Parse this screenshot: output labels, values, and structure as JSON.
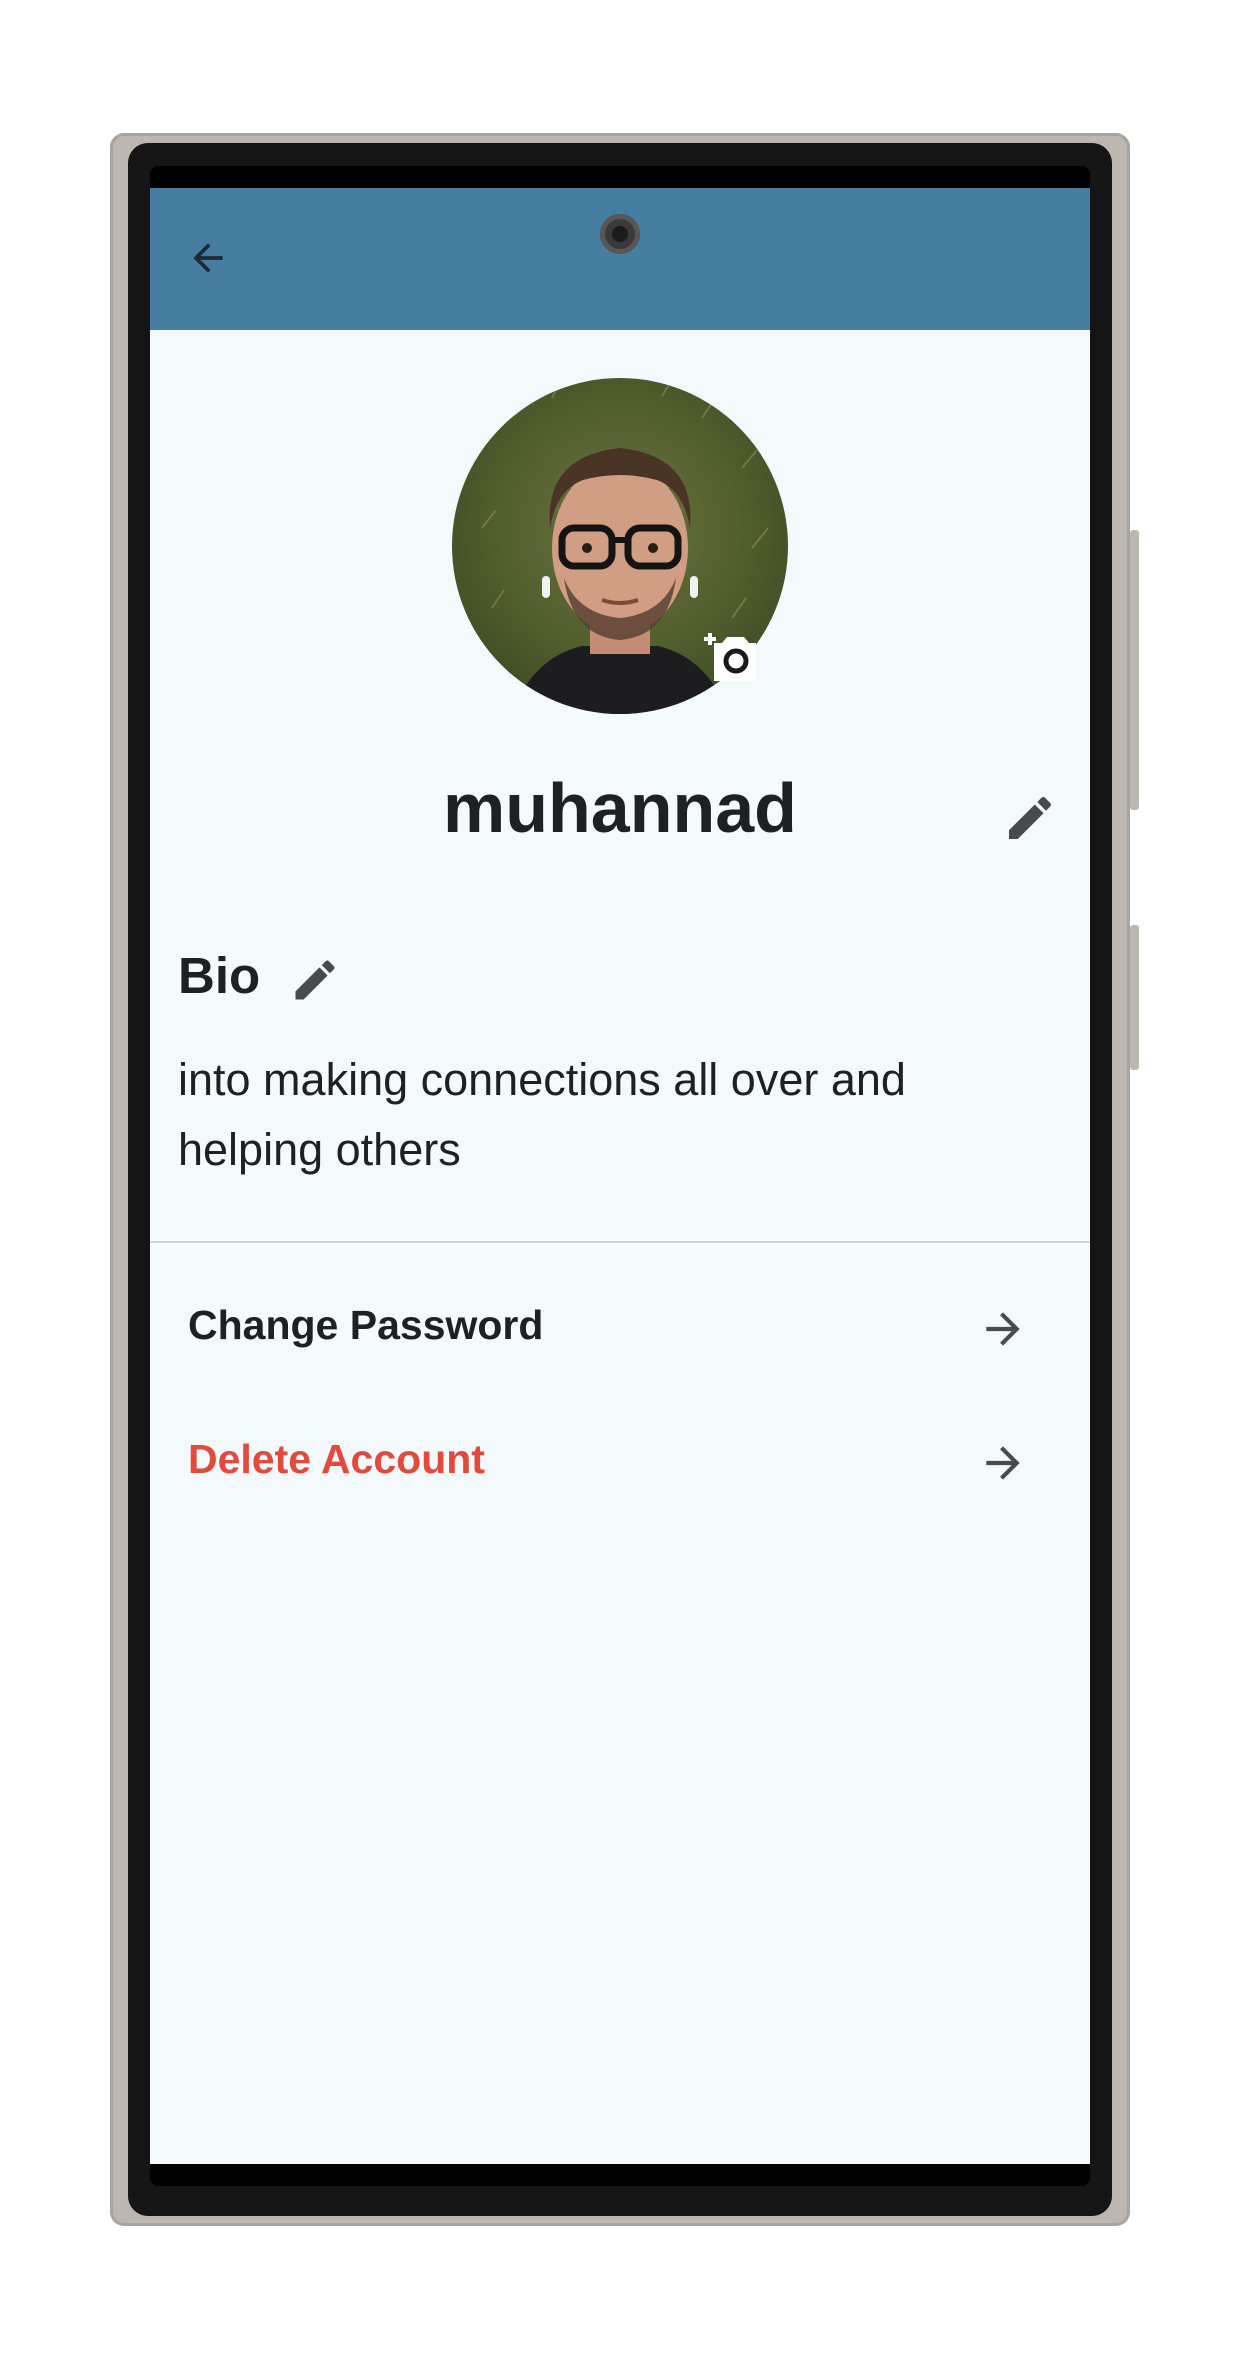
{
  "profile": {
    "username": "muhannad",
    "bio_title": "Bio",
    "bio_text": "into making connections all over and helping others"
  },
  "settings": {
    "items": [
      {
        "label": "Change Password",
        "color": "#1e2124"
      },
      {
        "label": "Delete Account",
        "color": "#e34a3c"
      }
    ]
  },
  "theme": {
    "app_bar": "#457ea0",
    "background": "#f4f9fc",
    "danger": "#e34a3c",
    "text": "#1e2124"
  },
  "icons": {
    "back": "arrow-left-icon",
    "add_photo": "add-a-photo-icon",
    "edit_name": "pencil-icon",
    "edit_bio": "pencil-icon",
    "item_arrow": "arrow-right-icon"
  }
}
